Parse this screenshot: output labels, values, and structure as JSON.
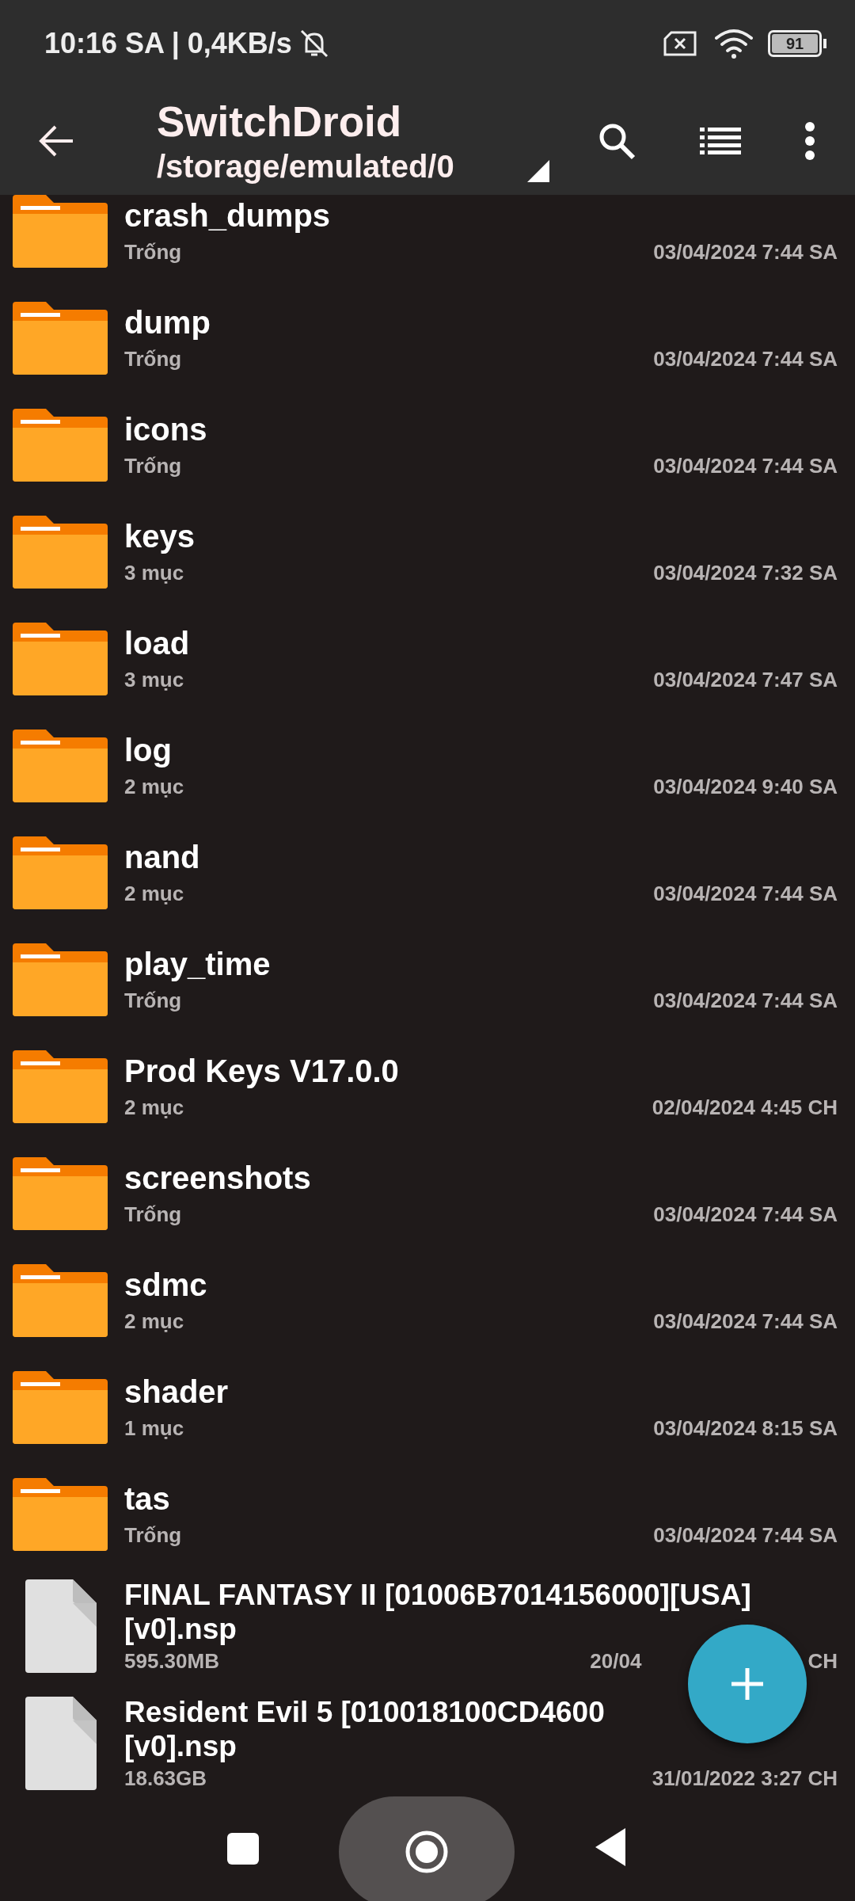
{
  "status_bar": {
    "time": "10:16 SA | 0,4KB/s",
    "battery": "91"
  },
  "app_bar": {
    "title": "SwitchDroid",
    "path": "/storage/emulated/0"
  },
  "items": [
    {
      "kind": "folder",
      "name": [
        "crash_dumps"
      ],
      "info": "Trống",
      "date": [
        "03/04/2024 7:44 SA"
      ]
    },
    {
      "kind": "folder",
      "name": [
        "dump"
      ],
      "info": "Trống",
      "date": [
        "03/04/2024 7:44 SA"
      ]
    },
    {
      "kind": "folder",
      "name": [
        "icons"
      ],
      "info": "Trống",
      "date": [
        "03/04/2024 7:44 SA"
      ]
    },
    {
      "kind": "folder",
      "name": [
        "keys"
      ],
      "info": "3 mục",
      "date": [
        "03/04/2024 7:32 SA"
      ]
    },
    {
      "kind": "folder",
      "name": [
        "load"
      ],
      "info": "3 mục",
      "date": [
        "03/04/2024 7:47 SA"
      ]
    },
    {
      "kind": "folder",
      "name": [
        "log"
      ],
      "info": "2 mục",
      "date": [
        "03/04/2024 9:40 SA"
      ]
    },
    {
      "kind": "folder",
      "name": [
        "nand"
      ],
      "info": "2 mục",
      "date": [
        "03/04/2024 7:44 SA"
      ]
    },
    {
      "kind": "folder",
      "name": [
        "play_time"
      ],
      "info": "Trống",
      "date": [
        "03/04/2024 7:44 SA"
      ]
    },
    {
      "kind": "folder",
      "name": [
        "Prod Keys V17.0.0"
      ],
      "info": "2 mục",
      "date": [
        "02/04/2024 4:45 CH"
      ]
    },
    {
      "kind": "folder",
      "name": [
        "screenshots"
      ],
      "info": "Trống",
      "date": [
        "03/04/2024 7:44 SA"
      ]
    },
    {
      "kind": "folder",
      "name": [
        "sdmc"
      ],
      "info": "2 mục",
      "date": [
        "03/04/2024 7:44 SA"
      ]
    },
    {
      "kind": "folder",
      "name": [
        "shader"
      ],
      "info": "1 mục",
      "date": [
        "03/04/2024 8:15 SA"
      ]
    },
    {
      "kind": "folder",
      "name": [
        "tas"
      ],
      "info": "Trống",
      "date": [
        "03/04/2024 7:44 SA"
      ]
    },
    {
      "kind": "file",
      "name": [
        "FINAL FANTASY II [01006B7014156000][USA]",
        "[v0].nsp"
      ],
      "info": "595.30MB",
      "date": [
        "20/04",
        "CH"
      ]
    },
    {
      "kind": "file",
      "name": [
        "Resident Evil 5 [010018100CD4600",
        "[v0].nsp"
      ],
      "info": "18.63GB",
      "date": [
        "31/01/2022 3:27 CH"
      ]
    }
  ]
}
